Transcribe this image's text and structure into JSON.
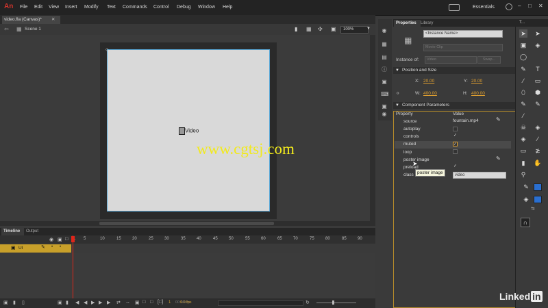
{
  "app": {
    "logo": "An"
  },
  "menu": [
    "File",
    "Edit",
    "View",
    "Insert",
    "Modify",
    "Text",
    "Commands",
    "Control",
    "Debug",
    "Window",
    "Help"
  ],
  "workspace": "Essentials",
  "document": {
    "tab_title": "video.fla (Canvas)*",
    "scene": "Scene 1",
    "zoom": "100%"
  },
  "stage": {
    "instance_label": "Video"
  },
  "watermark": "www.cgtsj.com",
  "timeline": {
    "tabs": [
      "Timeline",
      "Output"
    ],
    "layer_name": "UI",
    "ruler": [
      "1",
      "5",
      "10",
      "15",
      "20",
      "25",
      "30",
      "35",
      "40",
      "45",
      "50",
      "55",
      "60",
      "65",
      "70",
      "75",
      "80",
      "85",
      "90"
    ],
    "time": "00:00.0s",
    "fps": "0.0 fps"
  },
  "properties": {
    "tabs": [
      "Properties",
      "Library"
    ],
    "instance_name_placeholder": "<Instance Name>",
    "type": "Movie Clip",
    "instance_of_label": "Instance of:",
    "instance_of_value": "Video",
    "swap_label": "Swap...",
    "position_size": {
      "title": "Position and Size",
      "x_label": "X:",
      "x": "20.00",
      "y_label": "Y:",
      "y": "20.00",
      "w_label": "W:",
      "w": "400.00",
      "h_label": "H:",
      "h": "400.00"
    },
    "component_params": {
      "title": "Component Parameters",
      "col_property": "Property",
      "col_value": "Value",
      "rows": [
        {
          "name": "source",
          "value": "fountain.mp4"
        },
        {
          "name": "autoplay",
          "checked": false
        },
        {
          "name": "controls",
          "checked": true
        },
        {
          "name": "muted",
          "checked": true
        },
        {
          "name": "loop",
          "checked": false
        },
        {
          "name": "poster image",
          "value": ""
        },
        {
          "name": "preload",
          "checked": true
        },
        {
          "name": "class",
          "value": "video"
        }
      ]
    },
    "tooltip": "poster image"
  },
  "tools_title": "T...",
  "brand": {
    "linked": "Linked",
    "in": "in"
  },
  "colors": {
    "accent_orange": "#e0a030",
    "layer_gold": "#c8a02a",
    "playhead_red": "#e0261a",
    "watermark_yellow": "#f2ea1c",
    "swatch_blue": "#2a6fd0"
  }
}
